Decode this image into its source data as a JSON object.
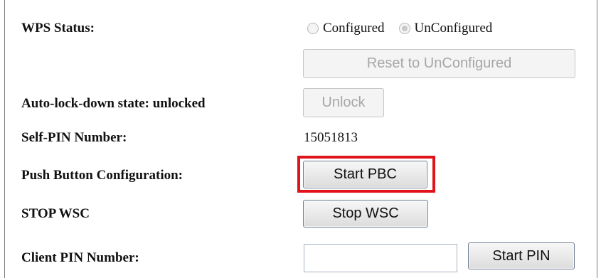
{
  "wps_status": {
    "label": "WPS Status:",
    "options": [
      {
        "label": "Configured",
        "selected": false
      },
      {
        "label": "UnConfigured",
        "selected": true
      }
    ],
    "reset_button": "Reset to UnConfigured"
  },
  "auto_lock": {
    "label": "Auto-lock-down state: unlocked",
    "unlock_button": "Unlock"
  },
  "self_pin": {
    "label": "Self-PIN Number:",
    "value": "15051813"
  },
  "pbc": {
    "label": "Push Button Configuration:",
    "button": "Start PBC",
    "highlight_color": "#e0131b"
  },
  "stop_wsc": {
    "label": "STOP WSC",
    "button": "Stop WSC"
  },
  "client_pin": {
    "label": "Client PIN Number:",
    "value": "",
    "button": "Start PIN"
  }
}
